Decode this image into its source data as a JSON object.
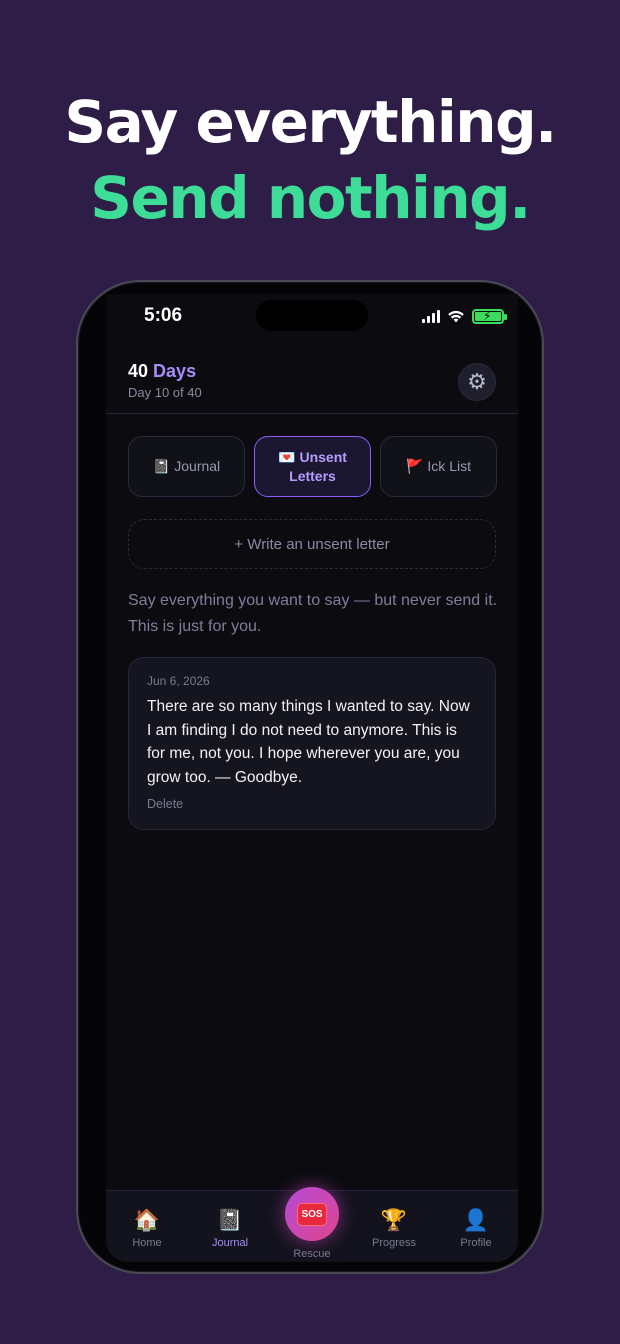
{
  "headline": {
    "line1": "Say everything.",
    "line2": "Send nothing."
  },
  "status_bar": {
    "time": "5:06"
  },
  "header": {
    "title_count": "40",
    "title_word": "Days",
    "subtitle": "Day 10 of 40",
    "settings_icon": "gear-icon"
  },
  "tabs": [
    {
      "icon": "📓",
      "label": "Journal",
      "active": false
    },
    {
      "icon": "💌",
      "label_line1": "Unsent",
      "label_line2": "Letters",
      "active": true
    },
    {
      "icon": "🚩",
      "label": "Ick List",
      "active": false
    }
  ],
  "write_button": "+ Write an unsent letter",
  "intro": "Say everything you want to say — but never send it. This is just for you.",
  "letters": [
    {
      "date": "Jun 6, 2026",
      "body": "There are so many things I wanted to say. Now I am finding I do not need to anymore. This is for me, not you. I hope wherever you are, you grow too. — Goodbye.",
      "delete_label": "Delete"
    }
  ],
  "nav": {
    "home": {
      "icon": "🏠",
      "label": "Home"
    },
    "journal": {
      "icon": "📓",
      "label": "Journal"
    },
    "rescue": {
      "badge": "SOS",
      "label": "Rescue"
    },
    "progress": {
      "icon": "🏆",
      "label": "Progress"
    },
    "profile": {
      "icon": "👤",
      "label": "Profile"
    }
  },
  "colors": {
    "background": "#2e1d47",
    "accent_green": "#3ddc97",
    "accent_purple": "#a78bfa",
    "sos_red": "#e8283c"
  }
}
